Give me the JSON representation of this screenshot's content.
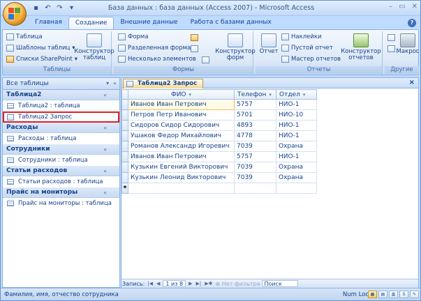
{
  "window": {
    "title": "База данных : база данных (Access 2007) - Microsoft Access"
  },
  "tabs": [
    "Главная",
    "Создание",
    "Внешние данные",
    "Работа с базами данных"
  ],
  "ribbon": {
    "tables": {
      "label": "Таблицы",
      "table": "Таблица",
      "templates": "Шаблоны таблиц",
      "sharepoint": "Списки SharePoint",
      "designer_l1": "Конструктор",
      "designer_l2": "таблиц"
    },
    "forms": {
      "label": "Формы",
      "form": "Форма",
      "split": "Разделенная форма",
      "multi": "Несколько элементов",
      "designer_l1": "Конструктор",
      "designer_l2": "форм"
    },
    "reports": {
      "label": "Отчеты",
      "report": "Отчет",
      "labels": "Наклейки",
      "empty": "Пустой отчет",
      "wizard": "Мастер отчетов",
      "designer_l1": "Конструктор",
      "designer_l2": "отчетов"
    },
    "other": {
      "label": "Другие",
      "macro": "Макрос"
    }
  },
  "nav": {
    "header": "Все таблицы",
    "groups": [
      {
        "name": "Таблица2",
        "items": [
          {
            "label": "Таблица2 : таблица",
            "type": "table"
          },
          {
            "label": "Таблица2 Запрос",
            "type": "query",
            "selected": true
          }
        ]
      },
      {
        "name": "Расходы",
        "items": [
          {
            "label": "Расходы : таблица",
            "type": "table"
          }
        ]
      },
      {
        "name": "Сотрудники",
        "items": [
          {
            "label": "Сотрудники : таблица",
            "type": "table"
          }
        ]
      },
      {
        "name": "Статьи расходов",
        "items": [
          {
            "label": "Статьи расходов : таблица",
            "type": "table"
          }
        ]
      },
      {
        "name": "Прайс на мониторы",
        "items": [
          {
            "label": "Прайс на мониторы : таблица",
            "type": "table"
          }
        ]
      }
    ]
  },
  "document": {
    "tab": "Таблица2 Запрос",
    "columns": [
      "ФИО",
      "Телефон",
      "Отдел"
    ],
    "rows": [
      [
        "Иванов Иван Петрович",
        "5757",
        "НИО-1"
      ],
      [
        "Петров Петр Иванович",
        "5701",
        "НИО-10"
      ],
      [
        "Сидоров Сидор Сидорович",
        "4893",
        "НИО-1"
      ],
      [
        "Ушаков Федор Михайлович",
        "4778",
        "НИО-1"
      ],
      [
        "Романов Александр Игоревич",
        "7039",
        "Охрана"
      ],
      [
        "Иванов Иван Петрович",
        "5757",
        "НИО-1"
      ],
      [
        "Кузькин Евгений Викторович",
        "7039",
        "Охрана"
      ],
      [
        "Кузькин Леонид Викторович",
        "7039",
        "Охрана"
      ]
    ],
    "new_row_marker": "*"
  },
  "record_nav": {
    "label": "Запись:",
    "position": "1 из 8",
    "no_filter": "Нет фильтра",
    "search": "Поиск"
  },
  "status": {
    "text": "Фамилия, имя, отчество сотрудника",
    "numlock": "Num Lock"
  }
}
